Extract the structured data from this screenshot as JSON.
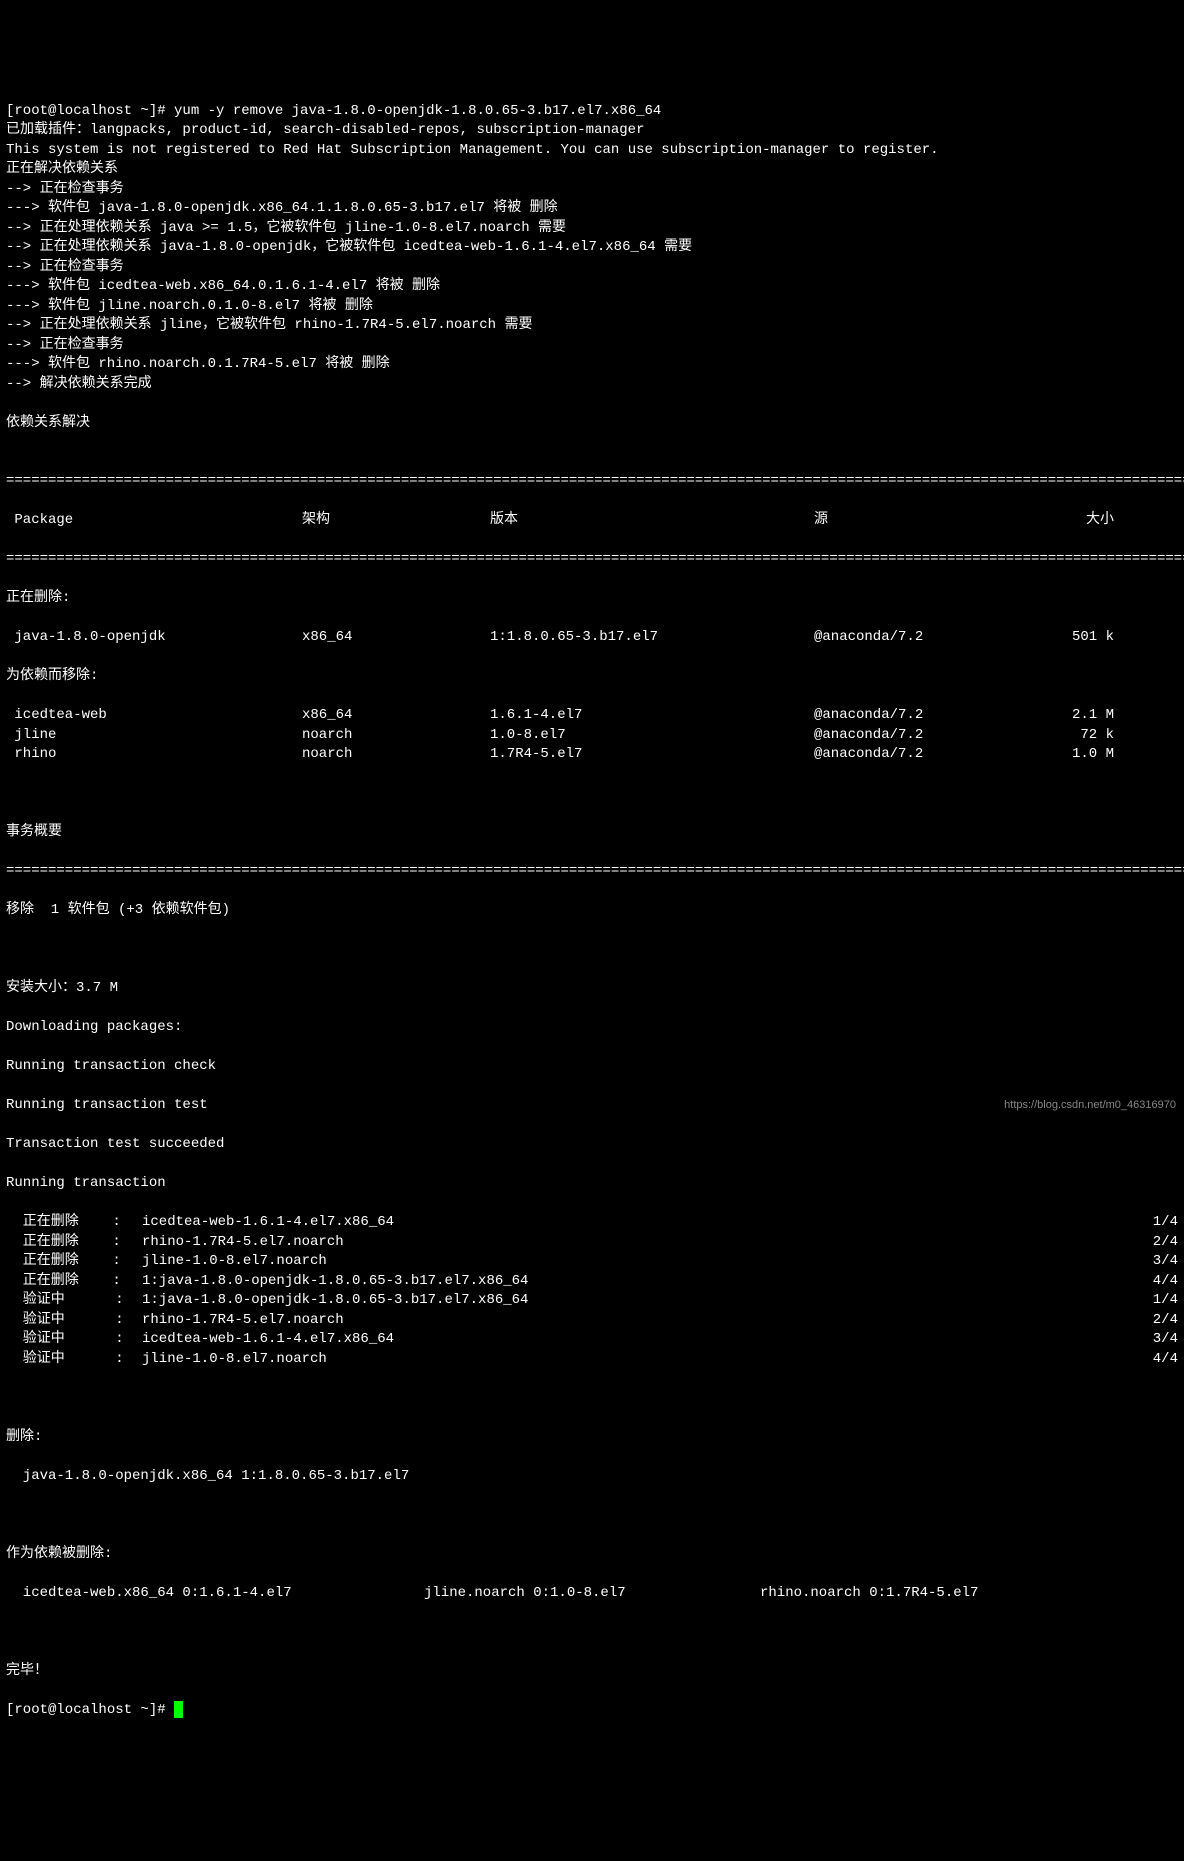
{
  "prompt1": "[root@localhost ~]# ",
  "command": "yum -y remove java-1.8.0-openjdk-1.8.0.65-3.b17.el7.x86_64",
  "lines_top": [
    "已加载插件：langpacks, product-id, search-disabled-repos, subscription-manager",
    "This system is not registered to Red Hat Subscription Management. You can use subscription-manager to register.",
    "正在解决依赖关系",
    "--> 正在检查事务",
    "---> 软件包 java-1.8.0-openjdk.x86_64.1.1.8.0.65-3.b17.el7 将被 删除",
    "--> 正在处理依赖关系 java >= 1.5，它被软件包 jline-1.0-8.el7.noarch 需要",
    "--> 正在处理依赖关系 java-1.8.0-openjdk，它被软件包 icedtea-web-1.6.1-4.el7.x86_64 需要",
    "--> 正在检查事务",
    "---> 软件包 icedtea-web.x86_64.0.1.6.1-4.el7 将被 删除",
    "---> 软件包 jline.noarch.0.1.0-8.el7 将被 删除",
    "--> 正在处理依赖关系 jline，它被软件包 rhino-1.7R4-5.el7.noarch 需要",
    "--> 正在检查事务",
    "---> 软件包 rhino.noarch.0.1.7R4-5.el7 将被 删除",
    "--> 解决依赖关系完成",
    "",
    "依赖关系解决",
    ""
  ],
  "divider": "================================================================================================================================================",
  "table_header": {
    "pkg": " Package",
    "arch": "架构",
    "ver": "版本",
    "repo": "源",
    "size": "大小"
  },
  "removing_header": "正在删除:",
  "removing_rows": [
    {
      "pkg": " java-1.8.0-openjdk",
      "arch": "x86_64",
      "ver": "1:1.8.0.65-3.b17.el7",
      "repo": "@anaconda/7.2",
      "size": "501 k"
    }
  ],
  "dep_remove_header": "为依赖而移除:",
  "dep_rows": [
    {
      "pkg": " icedtea-web",
      "arch": "x86_64",
      "ver": "1.6.1-4.el7",
      "repo": "@anaconda/7.2",
      "size": "2.1 M"
    },
    {
      "pkg": " jline",
      "arch": "noarch",
      "ver": "1.0-8.el7",
      "repo": "@anaconda/7.2",
      "size": "72 k"
    },
    {
      "pkg": " rhino",
      "arch": "noarch",
      "ver": "1.7R4-5.el7",
      "repo": "@anaconda/7.2",
      "size": "1.0 M"
    }
  ],
  "summary_header": "事务概要",
  "summary_line": "移除  1 软件包 (+3 依赖软件包)",
  "install_size": "安装大小：3.7 M",
  "dl": "Downloading packages:",
  "tx_check": "Running transaction check",
  "tx_test": "Running transaction test",
  "tx_succ": "Transaction test succeeded",
  "tx_run": "Running transaction",
  "tx_rows": [
    {
      "label": "  正在删除    : ",
      "pkg": "icedtea-web-1.6.1-4.el7.x86_64",
      "prog": "1/4"
    },
    {
      "label": "  正在删除    : ",
      "pkg": "rhino-1.7R4-5.el7.noarch",
      "prog": "2/4"
    },
    {
      "label": "  正在删除    : ",
      "pkg": "jline-1.0-8.el7.noarch",
      "prog": "3/4"
    },
    {
      "label": "  正在删除    : ",
      "pkg": "1:java-1.8.0-openjdk-1.8.0.65-3.b17.el7.x86_64",
      "prog": "4/4"
    },
    {
      "label": "  验证中      : ",
      "pkg": "1:java-1.8.0-openjdk-1.8.0.65-3.b17.el7.x86_64",
      "prog": "1/4"
    },
    {
      "label": "  验证中      : ",
      "pkg": "rhino-1.7R4-5.el7.noarch",
      "prog": "2/4"
    },
    {
      "label": "  验证中      : ",
      "pkg": "icedtea-web-1.6.1-4.el7.x86_64",
      "prog": "3/4"
    },
    {
      "label": "  验证中      : ",
      "pkg": "jline-1.0-8.el7.noarch",
      "prog": "4/4"
    }
  ],
  "removed_header": "删除:",
  "removed_line": "  java-1.8.0-openjdk.x86_64 1:1.8.0.65-3.b17.el7",
  "dep_removed_header": "作为依赖被删除:",
  "dep_removed": {
    "a": "  icedtea-web.x86_64 0:1.6.1-4.el7",
    "b": "jline.noarch 0:1.0-8.el7",
    "c": "rhino.noarch 0:1.7R4-5.el7"
  },
  "complete": "完毕！",
  "prompt2": "[root@localhost ~]# ",
  "watermark": "https://blog.csdn.net/m0_46316970"
}
